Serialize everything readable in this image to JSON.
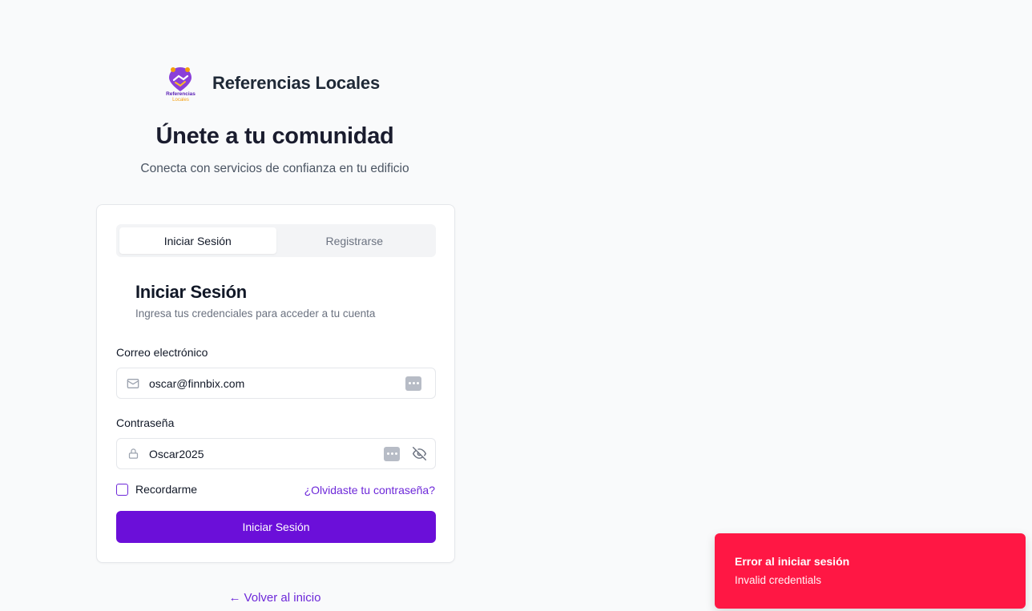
{
  "brand": {
    "name": "Referencias Locales",
    "logo_text_line1": "Referencias",
    "logo_text_line2": "Locales"
  },
  "hero": {
    "title": "Únete a tu comunidad",
    "subtitle": "Conecta con servicios de confianza en tu edificio"
  },
  "tabs": [
    {
      "label": "Iniciar Sesión",
      "active": true
    },
    {
      "label": "Registrarse",
      "active": false
    }
  ],
  "form": {
    "title": "Iniciar Sesión",
    "subtitle": "Ingresa tus credenciales para acceder a tu cuenta",
    "email_label": "Correo electrónico",
    "email_value": "oscar@finnbix.com",
    "password_label": "Contraseña",
    "password_value": "Oscar2025",
    "remember_label": "Recordarme",
    "remember_checked": false,
    "forgot_link": "¿Olvidaste tu contraseña?",
    "submit_label": "Iniciar Sesión"
  },
  "back_link": "Volver al inicio",
  "toast": {
    "title": "Error al iniciar sesión",
    "message": "Invalid credentials",
    "color": "#ff1744"
  },
  "colors": {
    "accent": "#6b0fd9",
    "background": "#f9fafb"
  }
}
